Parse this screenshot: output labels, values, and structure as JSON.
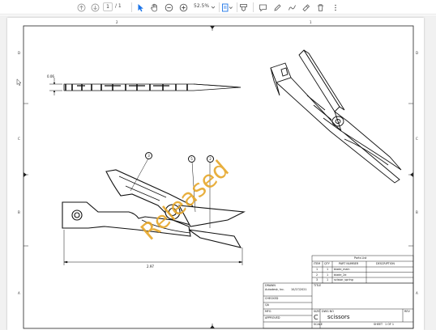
{
  "toolbar": {
    "page_current": "1",
    "page_separator": "/ 1",
    "zoom": "52.5%",
    "icons": [
      "page-up-icon",
      "page-down-icon",
      "select-cursor-icon",
      "hand-pan-icon",
      "zoom-out-icon",
      "zoom-in-icon",
      "zoom-dropdown-icon",
      "page-fit-icon",
      "highlight-icon",
      "comment-icon",
      "pen-icon",
      "draw-icon",
      "stamp-icon",
      "delete-icon",
      "more-icon"
    ]
  },
  "drawing": {
    "zones_top": [
      "2",
      "1"
    ],
    "zones_side": [
      "D",
      "C",
      "B",
      "A"
    ],
    "dim_thickness": "0.06",
    "dim_length": "2.97",
    "balloons": [
      "3",
      "5",
      "2"
    ],
    "watermark": "Released",
    "parts_list": {
      "title": "Parts List",
      "headers": [
        "ITEM",
        "QTY",
        "PART NUMBER",
        "DESCRIPTION"
      ],
      "rows": [
        [
          "1",
          "1",
          "blade_main",
          ""
        ],
        [
          "2",
          "1",
          "blade_2d",
          ""
        ],
        [
          "3",
          "1",
          "scissor_spring",
          ""
        ]
      ]
    },
    "title_block": {
      "drawn_label": "DRAWN",
      "drawn_by": "Autodesk, Inc.",
      "drawn_date": "10/27/2021",
      "checked_label": "CHECKED",
      "qa_label": "QA",
      "mfg_label": "MFG",
      "approved_label": "APPROVED",
      "title_label": "TITLE",
      "size_label": "SIZE",
      "size": "C",
      "dwg_label": "DWG NO",
      "dwg_no": "scissors",
      "rev_label": "REV",
      "scale_label": "SCALE",
      "sheet_label": "SHEET",
      "sheet_text": "1   OF   1"
    }
  }
}
